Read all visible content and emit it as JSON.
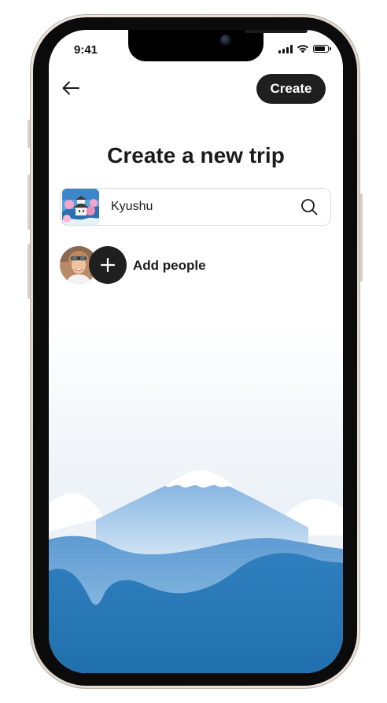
{
  "status_bar": {
    "time": "9:41",
    "icons": [
      "cellular-signal-icon",
      "wifi-icon",
      "battery-icon"
    ],
    "battery_level": 0.85
  },
  "header": {
    "back_icon": "arrow-left-icon",
    "create_label": "Create"
  },
  "page": {
    "title": "Create a new trip"
  },
  "destination": {
    "value": "Kyushu",
    "thumbnail": "castle-landscape-thumbnail",
    "search_icon": "search-icon"
  },
  "people": {
    "avatar": "user-avatar-photo",
    "add_icon": "plus-icon",
    "add_label": "Add people"
  },
  "colors": {
    "primary_button": "#1f1f1f",
    "text": "#1b1b1b",
    "field_border": "#dddddd",
    "sky_tint": "#e6eef6",
    "mountain_light": "#9ec3e6",
    "hills_dark": "#2676b4"
  }
}
